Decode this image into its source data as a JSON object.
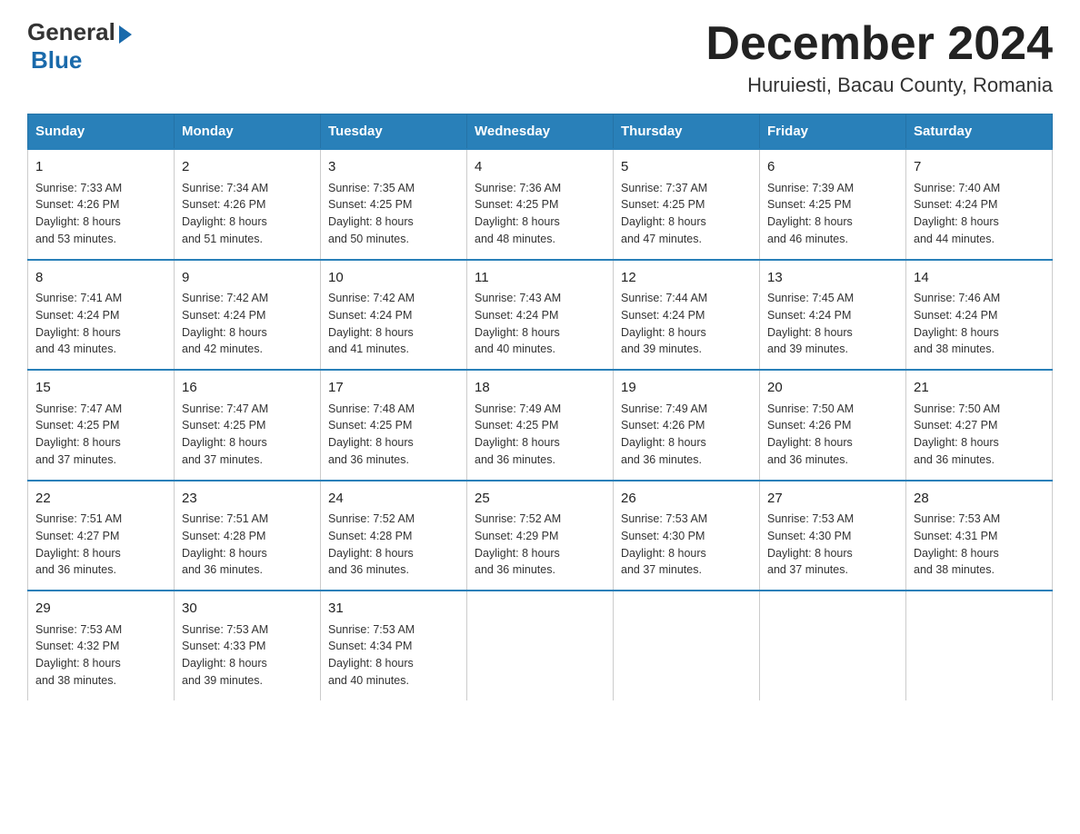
{
  "logo": {
    "general": "General",
    "blue": "Blue"
  },
  "title": "December 2024",
  "subtitle": "Huruiesti, Bacau County, Romania",
  "days_of_week": [
    "Sunday",
    "Monday",
    "Tuesday",
    "Wednesday",
    "Thursday",
    "Friday",
    "Saturday"
  ],
  "weeks": [
    [
      {
        "day": "1",
        "info": "Sunrise: 7:33 AM\nSunset: 4:26 PM\nDaylight: 8 hours\nand 53 minutes."
      },
      {
        "day": "2",
        "info": "Sunrise: 7:34 AM\nSunset: 4:26 PM\nDaylight: 8 hours\nand 51 minutes."
      },
      {
        "day": "3",
        "info": "Sunrise: 7:35 AM\nSunset: 4:25 PM\nDaylight: 8 hours\nand 50 minutes."
      },
      {
        "day": "4",
        "info": "Sunrise: 7:36 AM\nSunset: 4:25 PM\nDaylight: 8 hours\nand 48 minutes."
      },
      {
        "day": "5",
        "info": "Sunrise: 7:37 AM\nSunset: 4:25 PM\nDaylight: 8 hours\nand 47 minutes."
      },
      {
        "day": "6",
        "info": "Sunrise: 7:39 AM\nSunset: 4:25 PM\nDaylight: 8 hours\nand 46 minutes."
      },
      {
        "day": "7",
        "info": "Sunrise: 7:40 AM\nSunset: 4:24 PM\nDaylight: 8 hours\nand 44 minutes."
      }
    ],
    [
      {
        "day": "8",
        "info": "Sunrise: 7:41 AM\nSunset: 4:24 PM\nDaylight: 8 hours\nand 43 minutes."
      },
      {
        "day": "9",
        "info": "Sunrise: 7:42 AM\nSunset: 4:24 PM\nDaylight: 8 hours\nand 42 minutes."
      },
      {
        "day": "10",
        "info": "Sunrise: 7:42 AM\nSunset: 4:24 PM\nDaylight: 8 hours\nand 41 minutes."
      },
      {
        "day": "11",
        "info": "Sunrise: 7:43 AM\nSunset: 4:24 PM\nDaylight: 8 hours\nand 40 minutes."
      },
      {
        "day": "12",
        "info": "Sunrise: 7:44 AM\nSunset: 4:24 PM\nDaylight: 8 hours\nand 39 minutes."
      },
      {
        "day": "13",
        "info": "Sunrise: 7:45 AM\nSunset: 4:24 PM\nDaylight: 8 hours\nand 39 minutes."
      },
      {
        "day": "14",
        "info": "Sunrise: 7:46 AM\nSunset: 4:24 PM\nDaylight: 8 hours\nand 38 minutes."
      }
    ],
    [
      {
        "day": "15",
        "info": "Sunrise: 7:47 AM\nSunset: 4:25 PM\nDaylight: 8 hours\nand 37 minutes."
      },
      {
        "day": "16",
        "info": "Sunrise: 7:47 AM\nSunset: 4:25 PM\nDaylight: 8 hours\nand 37 minutes."
      },
      {
        "day": "17",
        "info": "Sunrise: 7:48 AM\nSunset: 4:25 PM\nDaylight: 8 hours\nand 36 minutes."
      },
      {
        "day": "18",
        "info": "Sunrise: 7:49 AM\nSunset: 4:25 PM\nDaylight: 8 hours\nand 36 minutes."
      },
      {
        "day": "19",
        "info": "Sunrise: 7:49 AM\nSunset: 4:26 PM\nDaylight: 8 hours\nand 36 minutes."
      },
      {
        "day": "20",
        "info": "Sunrise: 7:50 AM\nSunset: 4:26 PM\nDaylight: 8 hours\nand 36 minutes."
      },
      {
        "day": "21",
        "info": "Sunrise: 7:50 AM\nSunset: 4:27 PM\nDaylight: 8 hours\nand 36 minutes."
      }
    ],
    [
      {
        "day": "22",
        "info": "Sunrise: 7:51 AM\nSunset: 4:27 PM\nDaylight: 8 hours\nand 36 minutes."
      },
      {
        "day": "23",
        "info": "Sunrise: 7:51 AM\nSunset: 4:28 PM\nDaylight: 8 hours\nand 36 minutes."
      },
      {
        "day": "24",
        "info": "Sunrise: 7:52 AM\nSunset: 4:28 PM\nDaylight: 8 hours\nand 36 minutes."
      },
      {
        "day": "25",
        "info": "Sunrise: 7:52 AM\nSunset: 4:29 PM\nDaylight: 8 hours\nand 36 minutes."
      },
      {
        "day": "26",
        "info": "Sunrise: 7:53 AM\nSunset: 4:30 PM\nDaylight: 8 hours\nand 37 minutes."
      },
      {
        "day": "27",
        "info": "Sunrise: 7:53 AM\nSunset: 4:30 PM\nDaylight: 8 hours\nand 37 minutes."
      },
      {
        "day": "28",
        "info": "Sunrise: 7:53 AM\nSunset: 4:31 PM\nDaylight: 8 hours\nand 38 minutes."
      }
    ],
    [
      {
        "day": "29",
        "info": "Sunrise: 7:53 AM\nSunset: 4:32 PM\nDaylight: 8 hours\nand 38 minutes."
      },
      {
        "day": "30",
        "info": "Sunrise: 7:53 AM\nSunset: 4:33 PM\nDaylight: 8 hours\nand 39 minutes."
      },
      {
        "day": "31",
        "info": "Sunrise: 7:53 AM\nSunset: 4:34 PM\nDaylight: 8 hours\nand 40 minutes."
      },
      null,
      null,
      null,
      null
    ]
  ],
  "colors": {
    "header_bg": "#2980b9",
    "header_text": "#ffffff",
    "border": "#2573a7",
    "week_border": "#2980b9"
  }
}
